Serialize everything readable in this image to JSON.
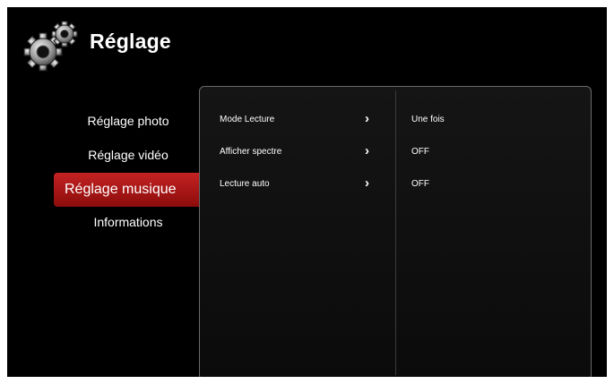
{
  "header": {
    "title": "Réglage",
    "icon": "gears-icon"
  },
  "sidebar": {
    "items": [
      {
        "label": "Réglage photo",
        "active": false
      },
      {
        "label": "Réglage vidéo",
        "active": false
      },
      {
        "label": "Réglage musique",
        "active": true
      },
      {
        "label": "Informations",
        "active": false
      }
    ]
  },
  "settings": [
    {
      "label": "Mode Lecture",
      "value": "Une fois",
      "icon": "chevron-right-icon"
    },
    {
      "label": "Afficher spectre",
      "value": "OFF",
      "icon": "chevron-right-icon"
    },
    {
      "label": "Lecture auto",
      "value": "OFF",
      "icon": "chevron-right-icon"
    }
  ],
  "chevron_glyph": "›",
  "colors": {
    "accent": "#b01a1a",
    "background": "#000000",
    "text": "#ffffff",
    "panel_border": "#6a6a6a"
  }
}
